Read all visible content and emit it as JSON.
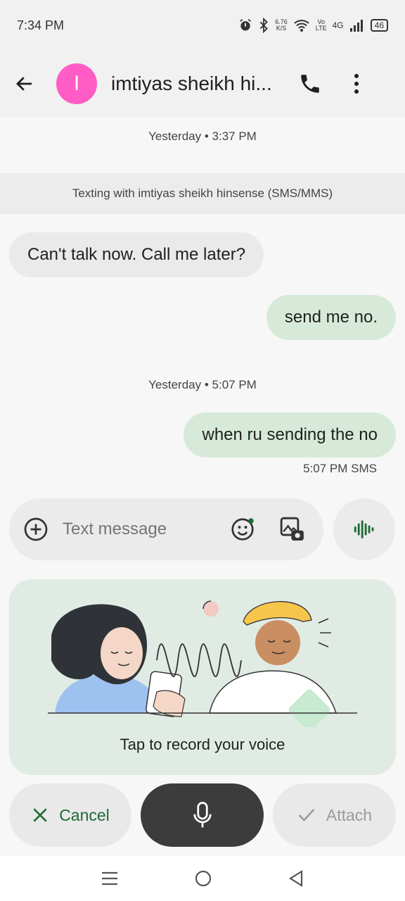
{
  "status_bar": {
    "time": "7:34 PM",
    "net_speed_value": "6.76",
    "net_speed_unit": "K/S",
    "volte_top": "Vo",
    "volte_bottom": "LTE",
    "network": "4G",
    "battery": "46",
    "icons": [
      "alarm-icon",
      "bluetooth-icon",
      "wifi-icon",
      "signal-icon",
      "battery-icon"
    ]
  },
  "app_bar": {
    "avatar_letter": "I",
    "avatar_color": "#ff5cc5",
    "contact_name": "imtiyas sheikh hi...",
    "icons": [
      "back-arrow-icon",
      "phone-icon",
      "more-vert-icon"
    ]
  },
  "conversation": {
    "timestamp_1": "Yesterday • 3:37 PM",
    "sms_banner": "Texting with imtiyas sheikh hinsense (SMS/MMS)",
    "msg_1": "Can't talk now. Call me later?",
    "msg_2": "send me no.",
    "timestamp_2": "Yesterday • 5:07 PM",
    "msg_3": "when ru sending the no",
    "msg_3_meta": "5:07 PM  SMS"
  },
  "compose": {
    "placeholder": "Text message",
    "icons": [
      "add-circle-icon",
      "emoji-icon",
      "gallery-icon",
      "voice-wave-icon"
    ]
  },
  "voice_card": {
    "caption": "Tap to record your voice"
  },
  "actions": {
    "cancel_label": "Cancel",
    "attach_label": "Attach"
  },
  "colors": {
    "accent_green": "#1e6b36",
    "outgoing_bubble": "#d7ead9",
    "card_bg": "#e0ebe4",
    "mic_button": "#3c3c3c"
  }
}
